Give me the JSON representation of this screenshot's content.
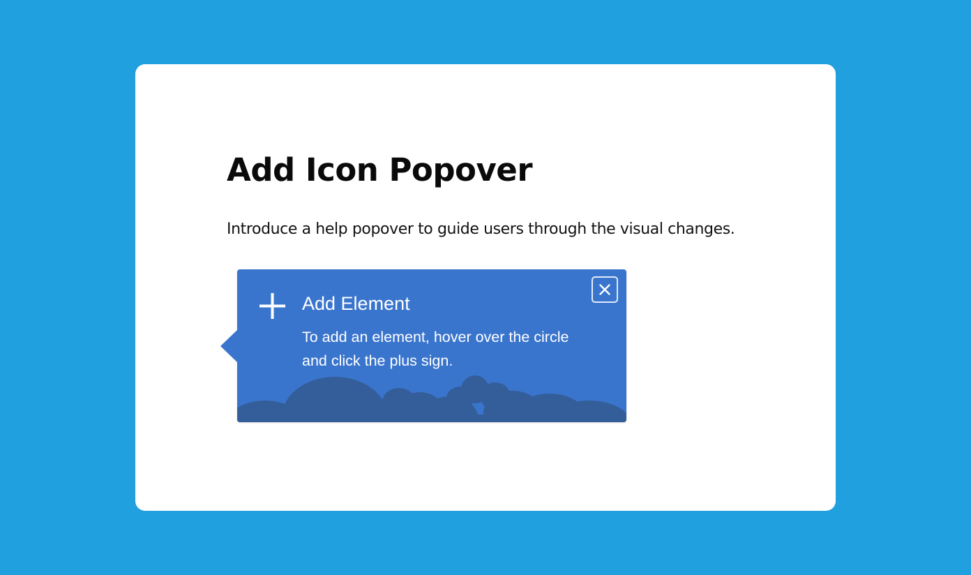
{
  "card": {
    "title": "Add Icon Popover",
    "description": "Introduce a help popover to guide users through the visual changes."
  },
  "popover": {
    "icon": "plus-icon",
    "title": "Add Element",
    "body": "To add an element, hover over the circle and click the plus sign.",
    "close_icon": "close-icon"
  },
  "colors": {
    "page_background": "#21a0df",
    "card_background": "#ffffff",
    "popover_background": "#3a75cd",
    "cloud_color": "#345e9a",
    "text_on_popover": "#ffffff"
  }
}
